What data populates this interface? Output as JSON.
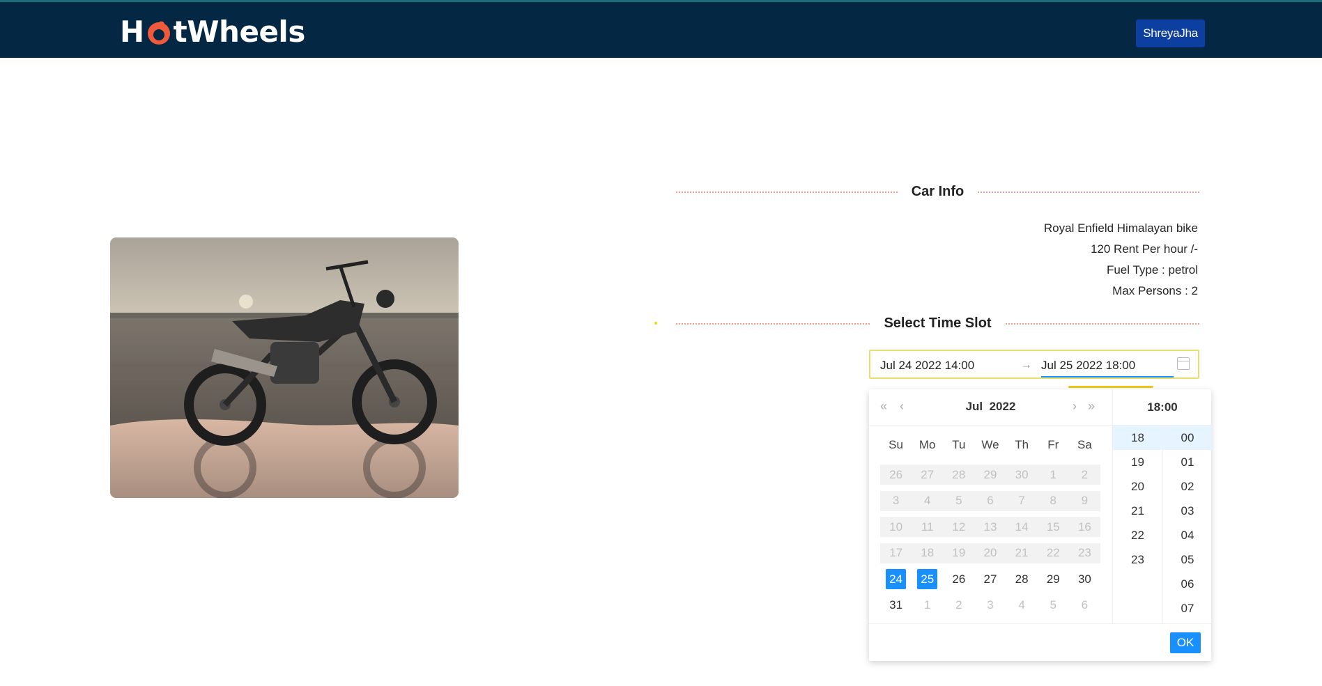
{
  "header": {
    "logo_pre": "H",
    "logo_post": "tWheels",
    "user_button": "ShreyaJha"
  },
  "car_info": {
    "section_title": "Car Info",
    "name": "Royal Enfield Himalayan bike",
    "rent": "120 Rent Per hour /-",
    "fuel": "Fuel Type : petrol",
    "persons": "Max Persons : 2"
  },
  "time_slot": {
    "section_title": "Select Time Slot",
    "start_value": "Jul 24 2022 14:00",
    "end_value": "Jul 25 2022 18:00",
    "arrow": "→"
  },
  "picker": {
    "month": "Jul",
    "year": "2022",
    "nav": {
      "prev_year": "«",
      "prev": "‹",
      "next": "›",
      "next_year": "»"
    },
    "weekdays": [
      "Su",
      "Mo",
      "Tu",
      "We",
      "Th",
      "Fr",
      "Sa"
    ],
    "weeks": [
      [
        {
          "d": "26",
          "s": "dis"
        },
        {
          "d": "27",
          "s": "dis"
        },
        {
          "d": "28",
          "s": "dis"
        },
        {
          "d": "29",
          "s": "dis"
        },
        {
          "d": "30",
          "s": "dis"
        },
        {
          "d": "1",
          "s": "dis"
        },
        {
          "d": "2",
          "s": "dis"
        }
      ],
      [
        {
          "d": "3",
          "s": "dis"
        },
        {
          "d": "4",
          "s": "dis"
        },
        {
          "d": "5",
          "s": "dis"
        },
        {
          "d": "6",
          "s": "dis"
        },
        {
          "d": "7",
          "s": "dis"
        },
        {
          "d": "8",
          "s": "dis"
        },
        {
          "d": "9",
          "s": "dis"
        }
      ],
      [
        {
          "d": "10",
          "s": "dis"
        },
        {
          "d": "11",
          "s": "dis"
        },
        {
          "d": "12",
          "s": "dis"
        },
        {
          "d": "13",
          "s": "dis"
        },
        {
          "d": "14",
          "s": "dis"
        },
        {
          "d": "15",
          "s": "dis"
        },
        {
          "d": "16",
          "s": "dis"
        }
      ],
      [
        {
          "d": "17",
          "s": "dis"
        },
        {
          "d": "18",
          "s": "dis"
        },
        {
          "d": "19",
          "s": "dis"
        },
        {
          "d": "20",
          "s": "dis"
        },
        {
          "d": "21",
          "s": "dis"
        },
        {
          "d": "22",
          "s": "dis"
        },
        {
          "d": "23",
          "s": "dis"
        }
      ],
      [
        {
          "d": "24",
          "s": "sel"
        },
        {
          "d": "25",
          "s": "sel"
        },
        {
          "d": "26",
          "s": ""
        },
        {
          "d": "27",
          "s": ""
        },
        {
          "d": "28",
          "s": ""
        },
        {
          "d": "29",
          "s": ""
        },
        {
          "d": "30",
          "s": ""
        }
      ],
      [
        {
          "d": "31",
          "s": ""
        },
        {
          "d": "1",
          "s": "out"
        },
        {
          "d": "2",
          "s": "out"
        },
        {
          "d": "3",
          "s": "out"
        },
        {
          "d": "4",
          "s": "out"
        },
        {
          "d": "5",
          "s": "out"
        },
        {
          "d": "6",
          "s": "out"
        }
      ]
    ],
    "time_header": "18:00",
    "hours": [
      "18",
      "19",
      "20",
      "21",
      "22",
      "23"
    ],
    "minutes": [
      "00",
      "01",
      "02",
      "03",
      "04",
      "05",
      "06",
      "07"
    ],
    "selected_hour": "18",
    "selected_minute": "00",
    "ok_label": "OK"
  },
  "colors": {
    "header_bg": "#042743",
    "accent": "#1890ff",
    "logo_flame": "#f05a3c",
    "divider": "#f59a8e"
  }
}
